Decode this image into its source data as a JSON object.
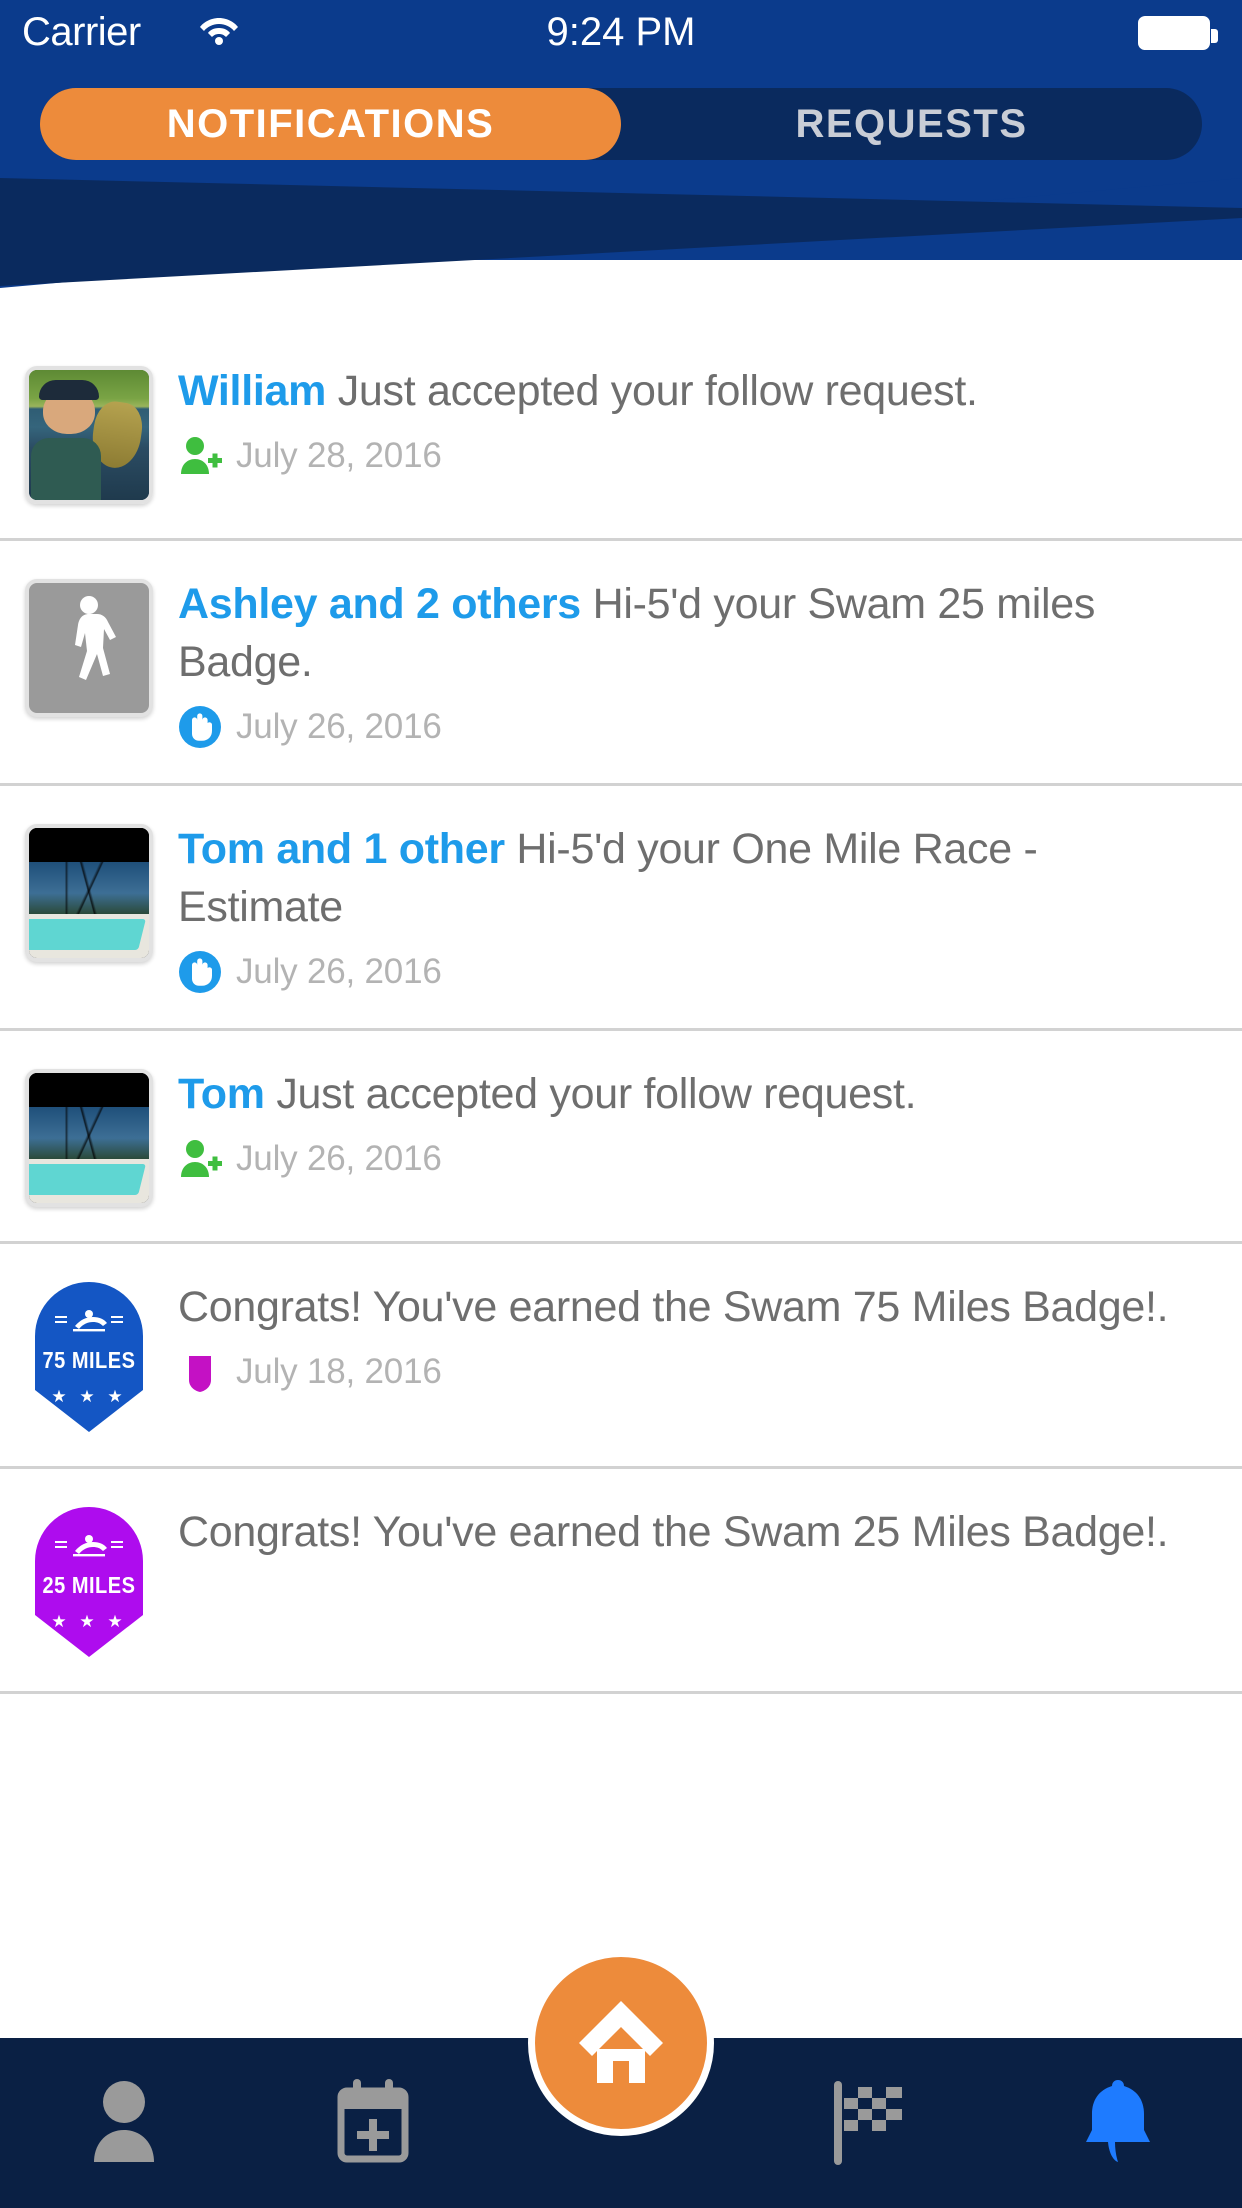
{
  "status_bar": {
    "carrier": "Carrier",
    "time": "9:24 PM",
    "wifi_icon": "wifi-icon",
    "battery_icon": "battery-full-icon"
  },
  "tabs": [
    {
      "label": "NOTIFICATIONS",
      "active": true
    },
    {
      "label": "REQUESTS",
      "active": false
    }
  ],
  "colors": {
    "header_blue": "#0B3B8C",
    "header_dark_navy": "#0A2A5E",
    "accent_orange": "#ED8B3B",
    "name_blue": "#1E9BEA",
    "body_gray": "#6E6E6E",
    "date_gray": "#B3B3B3",
    "follow_green": "#3FBE3F",
    "hi5_blue": "#1E9BEA",
    "badge_purple": "#AE0CEE",
    "badge_blue": "#1456C4",
    "nav_navy": "#0A2044",
    "nav_icon_gray": "#9A9A9A",
    "nav_icon_active": "#1E7BFF",
    "divider": "#D2D2D2"
  },
  "notifications": [
    {
      "name": "William",
      "text": " Just accepted your follow request.",
      "date": "July 28, 2016",
      "type_icon": "person-add-icon",
      "avatar": "photo-fishing"
    },
    {
      "name": "Ashley and 2 others",
      "text": " Hi-5'd your Swam 25 miles Badge.",
      "date": "July 26, 2016",
      "type_icon": "hi5-hand-icon",
      "avatar": "walking-person-placeholder"
    },
    {
      "name": "Tom and 1 other",
      "text": " Hi-5'd your One Mile Race - Estimate",
      "date": "July 26, 2016",
      "type_icon": "hi5-hand-icon",
      "avatar": "photo-pool"
    },
    {
      "name": "Tom",
      "text": " Just accepted your follow request.",
      "date": "July 26, 2016",
      "type_icon": "person-add-icon",
      "avatar": "photo-pool"
    },
    {
      "name": "",
      "text": "Congrats! You've earned the Swam 75 Miles Badge!.",
      "date": "July 18, 2016",
      "type_icon": "badge-shield-icon",
      "avatar": "badge-blue",
      "badge_label": "75 MILES",
      "badge_stars": "★ ★ ★"
    },
    {
      "name": "",
      "text": "Congrats! You've earned the Swam 25 Miles Badge!.",
      "date": "",
      "type_icon": "",
      "avatar": "badge-purple",
      "badge_label": "25 MILES",
      "badge_stars": "★ ★ ★"
    }
  ],
  "bottom_nav": [
    {
      "icon": "person-icon",
      "active": false
    },
    {
      "icon": "calendar-plus-icon",
      "active": false
    },
    {
      "icon": "home-icon",
      "active": false,
      "is_fab": true
    },
    {
      "icon": "checkered-flag-icon",
      "active": false
    },
    {
      "icon": "bell-icon",
      "active": true
    }
  ]
}
